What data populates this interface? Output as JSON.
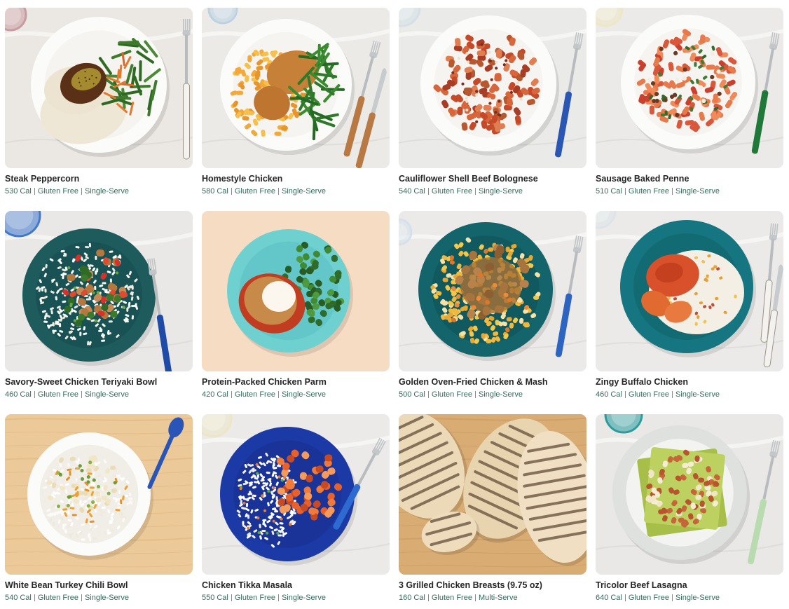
{
  "meals": [
    {
      "name": "Steak Peppercorn",
      "calories": "530",
      "cal_unit": "Cal",
      "tags": [
        "Gluten Free",
        "Single-Serve"
      ]
    },
    {
      "name": "Homestyle Chicken",
      "calories": "580",
      "cal_unit": "Cal",
      "tags": [
        "Gluten Free",
        "Single-Serve"
      ]
    },
    {
      "name": "Cauliflower Shell Beef Bolognese",
      "calories": "540",
      "cal_unit": "Cal",
      "tags": [
        "Gluten Free",
        "Single-Serve"
      ]
    },
    {
      "name": "Sausage Baked Penne",
      "calories": "510",
      "cal_unit": "Cal",
      "tags": [
        "Gluten Free",
        "Single-Serve"
      ]
    },
    {
      "name": "Savory-Sweet Chicken Teriyaki Bowl",
      "calories": "460",
      "cal_unit": "Cal",
      "tags": [
        "Gluten Free",
        "Single-Serve"
      ]
    },
    {
      "name": "Protein-Packed Chicken Parm",
      "calories": "420",
      "cal_unit": "Cal",
      "tags": [
        "Gluten Free",
        "Single-Serve"
      ]
    },
    {
      "name": "Golden Oven-Fried Chicken & Mash",
      "calories": "500",
      "cal_unit": "Cal",
      "tags": [
        "Gluten Free",
        "Single-Serve"
      ]
    },
    {
      "name": "Zingy Buffalo Chicken",
      "calories": "460",
      "cal_unit": "Cal",
      "tags": [
        "Gluten Free",
        "Single-Serve"
      ]
    },
    {
      "name": "White Bean Turkey Chili Bowl",
      "calories": "540",
      "cal_unit": "Cal",
      "tags": [
        "Gluten Free",
        "Single-Serve"
      ]
    },
    {
      "name": "Chicken Tikka Masala",
      "calories": "550",
      "cal_unit": "Cal",
      "tags": [
        "Gluten Free",
        "Single-Serve"
      ]
    },
    {
      "name": "3 Grilled Chicken Breasts (9.75 oz)",
      "calories": "160",
      "cal_unit": "Cal",
      "tags": [
        "Gluten Free",
        "Multi-Serve"
      ]
    },
    {
      "name": "Tricolor Beef Lasagna",
      "calories": "640",
      "cal_unit": "Cal",
      "tags": [
        "Gluten Free",
        "Single-Serve"
      ]
    }
  ]
}
